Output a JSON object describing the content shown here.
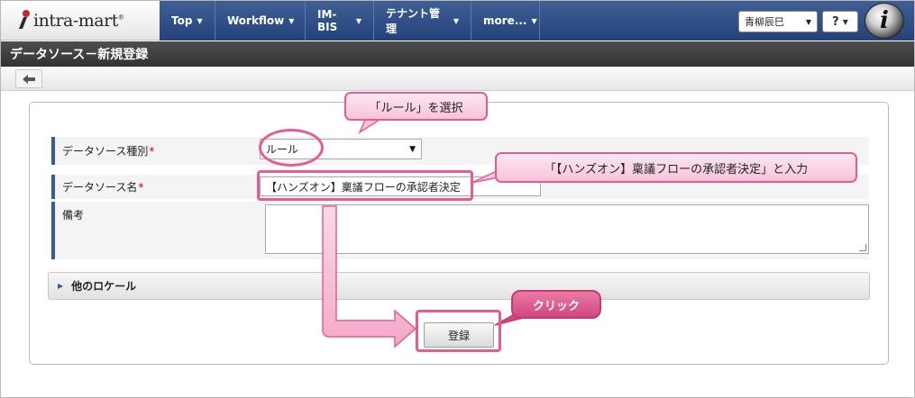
{
  "brand": {
    "logo_text": "intra-mart",
    "logo_reg": "®",
    "logo_letter": "i"
  },
  "nav": {
    "items": [
      {
        "label": "Top"
      },
      {
        "label": "Workflow"
      },
      {
        "label": "IM-BIS"
      },
      {
        "label": "テナント管理"
      },
      {
        "label": "more..."
      }
    ],
    "user_name": "青柳辰巳",
    "help_label": "?"
  },
  "page": {
    "title": "データソース－新規登録"
  },
  "toolbar": {
    "back_icon": "arrow-left-icon"
  },
  "form": {
    "type_label": "データソース種別",
    "type_value": "ルール",
    "name_label": "データソース名",
    "name_value": "【ハンズオン】稟議フローの承認者決定",
    "note_label": "備考",
    "note_value": "",
    "required_mark": "*",
    "locale_label": "他のロケール",
    "submit_label": "登録"
  },
  "annotations": {
    "callout_select": "「ルール」を選択",
    "callout_input": "「【ハンズオン】稟議フローの承認者決定」と入力",
    "callout_click": "クリック",
    "highlight_color": "#e45d92"
  },
  "colors": {
    "nav_bg": "#2d4c84",
    "title_bg": "#3f3f3f",
    "label_accent": "#355c99"
  }
}
